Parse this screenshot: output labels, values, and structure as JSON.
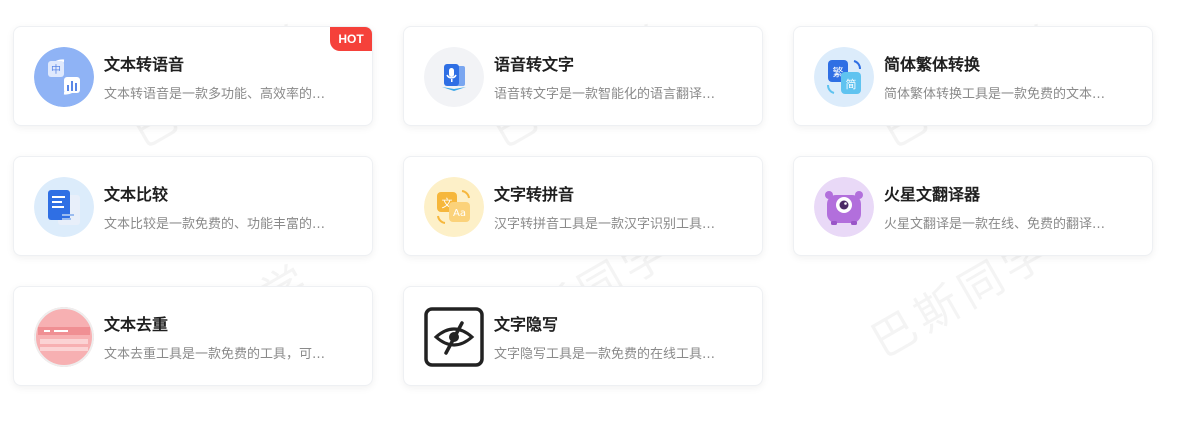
{
  "watermark_text": "巴斯同学",
  "cards": [
    {
      "title": "文本转语音",
      "description": "文本转语音是一款多功能、高效率的…",
      "icon": "text-to-speech-icon",
      "badge": "HOT",
      "badge_color": "#f5413a"
    },
    {
      "title": "语音转文字",
      "description": "语音转文字是一款智能化的语言翻译…",
      "icon": "speech-to-text-icon"
    },
    {
      "title": "简体繁体转换",
      "description": "简体繁体转换工具是一款免费的文本…",
      "icon": "traditional-simplified-icon"
    },
    {
      "title": "文本比较",
      "description": "文本比较是一款免费的、功能丰富的…",
      "icon": "text-compare-icon"
    },
    {
      "title": "文字转拼音",
      "description": "汉字转拼音工具是一款汉字识别工具…",
      "icon": "pinyin-icon"
    },
    {
      "title": "火星文翻译器",
      "description": "火星文翻译是一款在线、免费的翻译…",
      "icon": "mars-text-monster-icon"
    },
    {
      "title": "文本去重",
      "description": "文本去重工具是一款免费的工具，可…",
      "icon": "dedupe-icon"
    },
    {
      "title": "文字隐写",
      "description": "文字隐写工具是一款免费的在线工具…",
      "icon": "eye-slash-icon"
    }
  ]
}
